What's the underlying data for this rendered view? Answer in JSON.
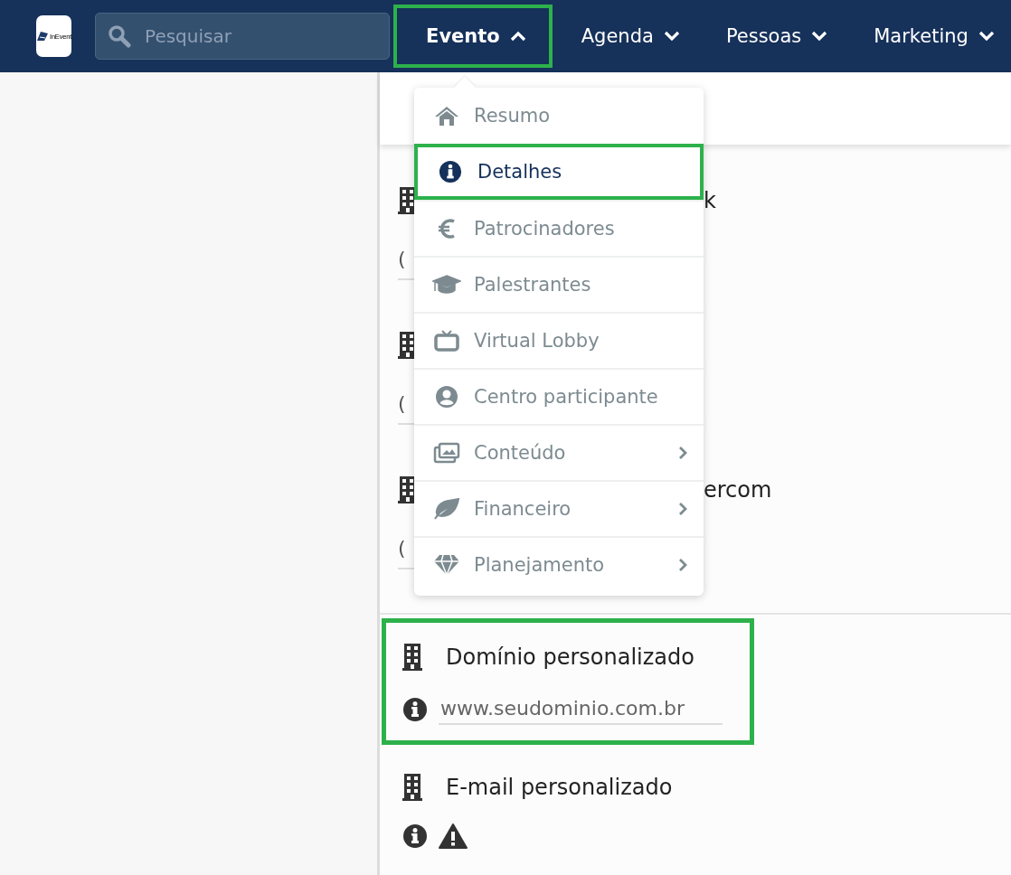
{
  "navbar": {
    "logo_text": "InEvent",
    "search": {
      "placeholder": "Pesquisar"
    },
    "items": [
      {
        "label": "Evento",
        "expanded": true,
        "highlighted": true
      },
      {
        "label": "Agenda",
        "expanded": false,
        "highlighted": false
      },
      {
        "label": "Pessoas",
        "expanded": false,
        "highlighted": false
      },
      {
        "label": "Marketing",
        "expanded": false,
        "highlighted": false
      }
    ]
  },
  "dropdown": {
    "items": [
      {
        "label": "Resumo",
        "selected": false,
        "highlighted": false,
        "submenu": false
      },
      {
        "label": "Detalhes",
        "selected": true,
        "highlighted": true,
        "submenu": false
      },
      {
        "label": "Patrocinadores",
        "selected": false,
        "highlighted": false,
        "submenu": false
      },
      {
        "label": "Palestrantes",
        "selected": false,
        "highlighted": false,
        "submenu": false
      },
      {
        "label": "Virtual Lobby",
        "selected": false,
        "highlighted": false,
        "submenu": false
      },
      {
        "label": "Centro participante",
        "selected": false,
        "highlighted": false,
        "submenu": false
      },
      {
        "label": "Conteúdo",
        "selected": false,
        "highlighted": false,
        "submenu": true
      },
      {
        "label": "Financeiro",
        "selected": false,
        "highlighted": false,
        "submenu": true
      },
      {
        "label": "Planejamento",
        "selected": false,
        "highlighted": false,
        "submenu": true
      }
    ]
  },
  "covered_sections": [
    {
      "label_tail": "k",
      "value": "("
    },
    {
      "value": "("
    },
    {
      "label_tail": "ercom",
      "value": "("
    }
  ],
  "sections": [
    {
      "label": "Domínio personalizado",
      "placeholder": "www.seudominio.com.br",
      "highlighted": true,
      "warning": false
    },
    {
      "label": "E-mail personalizado",
      "highlighted": false,
      "warning": true
    }
  ]
}
